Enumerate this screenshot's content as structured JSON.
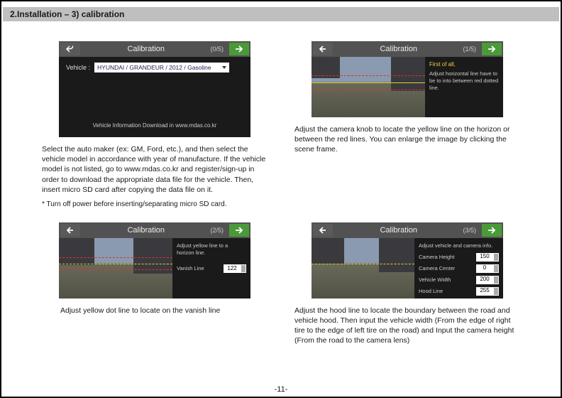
{
  "header": "2.Installation – 3) calibration",
  "pagenum": "-11-",
  "steps": {
    "s1": {
      "title": "Calibration",
      "count": "(0/5)",
      "vehicle_label": "Vehicle :",
      "vehicle_value": "HYUNDAI / GRANDEUR / 2012 / Gasoline",
      "footer": "Vehicle Information Download in www.mdas.co.kr",
      "caption": "Select the auto maker (ex: GM, Ford, etc.), and then select the vehicle model in accordance with year of manufacture. If the vehicle model is not listed, go to www.mdas.co.kr and register/sign-up in order to download the appropriate data file for the vehicle. Then, insert micro SD card after copying the data file on it.",
      "note": "* Turn off power before inserting/separating micro SD card."
    },
    "s2": {
      "title": "Calibration",
      "count": "(1/5)",
      "side_head": "First of all,",
      "side_body": "Adjust horizontal line have to be to into between red dotted line.",
      "caption": "Adjust the camera knob to locate the yellow line on the horizon or between the red lines. You can enlarge the image by clicking the scene frame."
    },
    "s3": {
      "title": "Calibration",
      "count": "(2/5)",
      "side_body": "Adjust yellow line to a horizon line.",
      "vanish_label": "Vanish Line",
      "vanish_value": "122",
      "caption": "Adjust yellow dot line to locate on the vanish line"
    },
    "s4": {
      "title": "Calibration",
      "count": "(3/5)",
      "side_head": "Adjust vehicle and camera  info.",
      "rows": {
        "camera_height": {
          "label": "Camera Height",
          "value": "150"
        },
        "camera_center": {
          "label": "Camera Center",
          "value": "0"
        },
        "vehicle_width": {
          "label": "Vehicle Width",
          "value": "200"
        },
        "hood_line": {
          "label": "Hood Line",
          "value": "255"
        }
      },
      "caption": "Adjust the hood line to locate the boundary between the road and vehicle hood.  Then input the vehicle width (From the edge of right tire to the edge of left tire on the road) and  Input the camera height (From the road to the camera lens)"
    }
  }
}
